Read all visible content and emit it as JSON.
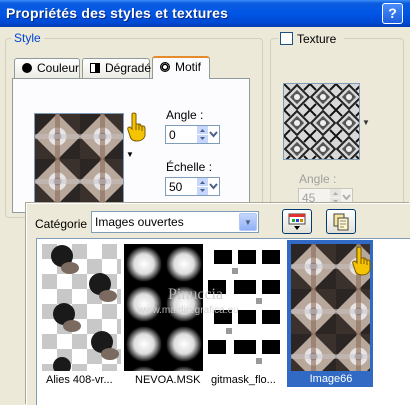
{
  "window": {
    "title": "Propriétés des styles et textures",
    "help_label": "?"
  },
  "style_group": {
    "legend": "Style",
    "tabs": [
      {
        "label": "Couleur",
        "icon": "color-dot-icon"
      },
      {
        "label": "Dégradé",
        "icon": "gradient-icon"
      },
      {
        "label": "Motif",
        "icon": "pattern-icon",
        "selected": true
      }
    ],
    "angle": {
      "label": "Angle :",
      "value": "0"
    },
    "scale": {
      "label": "Échelle :",
      "value": "50"
    }
  },
  "texture_group": {
    "label": "Texture",
    "checked": false,
    "angle": {
      "label": "Angle :",
      "value": "45"
    }
  },
  "picker": {
    "category_label": "Catégorie :",
    "category_value": "Images ouvertes",
    "thumbnails": [
      {
        "label": "Alies 408-vr..."
      },
      {
        "label": "NEVOA.MSK"
      },
      {
        "label": "gitmask_flo..."
      },
      {
        "label": "Image66",
        "selected": true
      }
    ],
    "watermark_line1": "Pinuccia",
    "watermark_line2": "www.maidiregrafica.eu"
  },
  "colors": {
    "title_bar": "#0054e3",
    "selection": "#316ac5",
    "dialog_bg": "#ece9d8",
    "legend_blue": "#0046d5"
  }
}
